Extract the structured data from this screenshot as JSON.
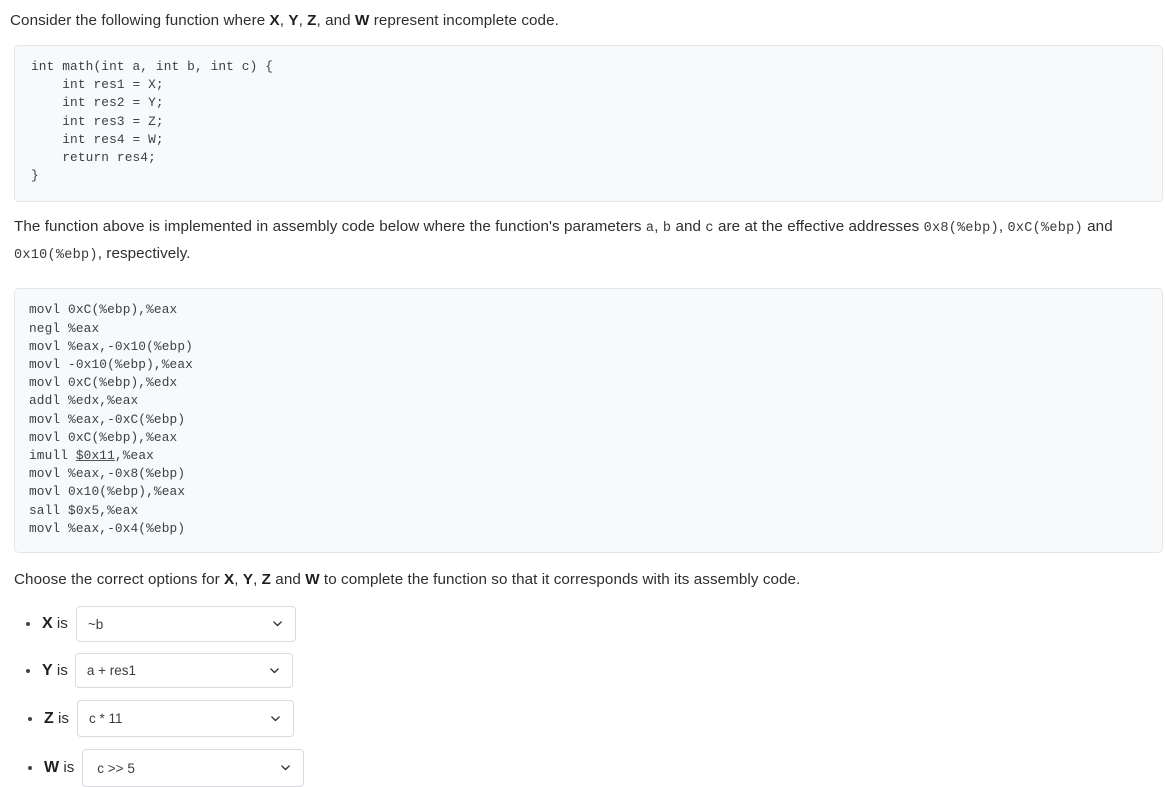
{
  "intro": {
    "prefix": "Consider the following function where ",
    "var1": "X",
    "sep1": ", ",
    "var2": "Y",
    "sep2": ", ",
    "var3": "Z",
    "sep3": ", and ",
    "var4": "W",
    "suffix": " represent incomplete code."
  },
  "c_code": {
    "text": "int math(int a, int b, int c) {\n    int res1 = X;\n    int res2 = Y;\n    int res3 = Z;\n    int res4 = W;\n    return res4;\n}"
  },
  "explanation": {
    "part1": "The function above is implemented in assembly code below where the function's parameters ",
    "code_a": "a",
    "part2": ", ",
    "code_b": "b",
    "part3": " and ",
    "code_c": "c",
    "part4": " are at the effective addresses ",
    "addr_a": "0x8(%ebp)",
    "part5": ", ",
    "addr_b": "0xC(%ebp)",
    "part6": " and ",
    "addr_c": "0x10(%ebp)",
    "part7": ", respectively."
  },
  "asm_code": {
    "lines_before": "movl 0xC(%ebp),%eax\nnegl %eax\nmovl %eax,-0x10(%ebp)\nmovl -0x10(%ebp),%eax\nmovl 0xC(%ebp),%edx\naddl %edx,%eax\nmovl %eax,-0xC(%ebp)\nmovl 0xC(%ebp),%eax\nimull ",
    "underlined": "$0x11",
    "lines_after": ",%eax\nmovl %eax,-0x8(%ebp)\nmovl 0x10(%ebp),%eax\nsall $0x5,%eax\nmovl %eax,-0x4(%ebp)",
    "full_text": "movl 0xC(%ebp),%eax\nnegl %eax\nmovl %eax,-0x10(%ebp)\nmovl -0x10(%ebp),%eax\nmovl 0xC(%ebp),%edx\naddl %edx,%eax\nmovl %eax,-0xC(%ebp)\nmovl 0xC(%ebp),%eax\nimull $0x11,%eax\nmovl %eax,-0x8(%ebp)\nmovl 0x10(%ebp),%eax\nsall $0x5,%eax\nmovl %eax,-0x4(%ebp)"
  },
  "instruction": {
    "prefix": "Choose the correct options for ",
    "var1": "X",
    "sep1": ", ",
    "var2": "Y",
    "sep2": ", ",
    "var3": "Z",
    "sep3": " and ",
    "var4": "W",
    "suffix": " to complete the function so that it corresponds with its assembly code."
  },
  "answers": [
    {
      "var": "X",
      "label_tail": " is",
      "value": "~b",
      "icon": "chevron-down-icon"
    },
    {
      "var": "Y",
      "label_tail": " is",
      "value": "a + res1",
      "icon": "chevron-down-icon"
    },
    {
      "var": "Z",
      "label_tail": " is",
      "value": "c * 11",
      "icon": "chevron-down-icon"
    },
    {
      "var": "W",
      "label_tail": " is",
      "value": "c >> 5",
      "icon": "chevron-down-icon"
    }
  ],
  "colors": {
    "code_background": "#f8f9fa",
    "code_border": "#e3e5e8",
    "text": "#2e2e2e",
    "select_border": "#d8dadd"
  }
}
